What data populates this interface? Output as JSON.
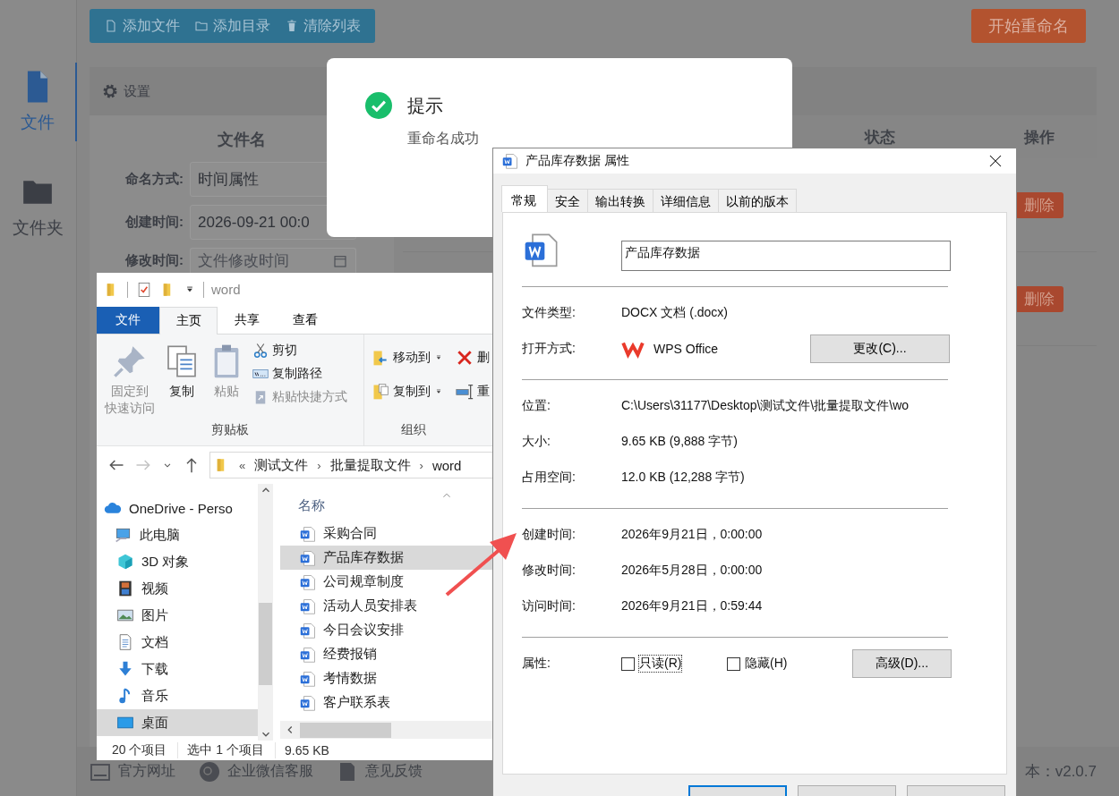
{
  "app": {
    "sidebar": [
      {
        "label": "文件",
        "selected": true
      },
      {
        "label": "文件夹",
        "selected": false
      }
    ],
    "toolbar": [
      "添加文件",
      "添加目录",
      "清除列表"
    ],
    "start_button": "开始重命名",
    "settings_title": "设置",
    "form": {
      "title": "文件名",
      "fields": [
        {
          "label": "命名方式:",
          "value": "时间属性"
        },
        {
          "label": "创建时间:",
          "value": "2026-09-21 00:0"
        },
        {
          "label": "修改时间:",
          "placeholder": "文件修改时间"
        }
      ]
    },
    "table": {
      "columns": [
        "状态",
        "操作"
      ],
      "rows": [
        {
          "action": "删除"
        },
        {
          "action": "删除"
        }
      ]
    },
    "footer": {
      "links": [
        "官方网址",
        "企业微信客服",
        "意见反馈"
      ],
      "version": "本：v2.0.7"
    }
  },
  "toast": {
    "title": "提示",
    "message": "重命名成功"
  },
  "explorer": {
    "title": "word",
    "file_tab": "文件",
    "tabs": [
      {
        "label": "主页",
        "selected": true
      },
      {
        "label": "共享",
        "selected": false
      },
      {
        "label": "查看",
        "selected": false
      }
    ],
    "clipboard": {
      "label": "剪贴板",
      "large": [
        {
          "lines": [
            "固定到",
            "快速访问"
          ],
          "disabled": true
        },
        {
          "lines": [
            "复制"
          ],
          "disabled": false
        },
        {
          "lines": [
            "粘贴"
          ],
          "disabled": true
        }
      ],
      "small": [
        {
          "label": "剪切",
          "disabled": false
        },
        {
          "label": "复制路径",
          "disabled": false
        },
        {
          "label": "粘贴快捷方式",
          "disabled": true
        }
      ]
    },
    "organize": {
      "label": "组织",
      "items": [
        {
          "label": "移动到",
          "dropdown": true
        },
        {
          "label": "删",
          "dropdown": false
        },
        {
          "label": "复制到",
          "dropdown": true
        },
        {
          "label": "重",
          "dropdown": false
        }
      ]
    },
    "nav_buttons": [
      {
        "disabled": false
      },
      {
        "disabled": true
      },
      {
        "disabled": false
      },
      {
        "disabled": false
      }
    ],
    "address": {
      "overflow": "«",
      "crumbs": [
        {
          "label": "测试文件"
        },
        {
          "separator": "›",
          "label": "批量提取文件"
        },
        {
          "separator": "›",
          "label": "word"
        }
      ]
    },
    "nav_pane": [
      {
        "label": "OneDrive - Perso",
        "selected": false
      },
      {
        "label": "此电脑",
        "selected": false,
        "children": [
          {
            "label": "3D 对象",
            "selected": false
          },
          {
            "label": "视频",
            "selected": false
          },
          {
            "label": "图片",
            "selected": false
          },
          {
            "label": "文档",
            "selected": false
          },
          {
            "label": "下载",
            "selected": false
          },
          {
            "label": "音乐",
            "selected": false
          },
          {
            "label": "桌面",
            "selected": true
          }
        ]
      }
    ],
    "column": "名称",
    "files": [
      {
        "name": "采购合同",
        "selected": false
      },
      {
        "name": "产品库存数据",
        "selected": true
      },
      {
        "name": "公司规章制度",
        "selected": false
      },
      {
        "name": "活动人员安排表",
        "selected": false
      },
      {
        "name": "今日会议安排",
        "selected": false
      },
      {
        "name": "经费报销",
        "selected": false
      },
      {
        "name": "考情数据",
        "selected": false
      },
      {
        "name": "客户联系表",
        "selected": false
      }
    ],
    "status": [
      "20 个项目",
      "选中 1 个项目",
      "9.65 KB"
    ]
  },
  "properties": {
    "title": "产品库存数据 属性",
    "tabs": [
      {
        "label": "常规",
        "selected": true
      },
      {
        "label": "安全",
        "selected": false
      },
      {
        "label": "输出转换",
        "selected": false
      },
      {
        "label": "详细信息",
        "selected": false
      },
      {
        "label": "以前的版本",
        "selected": false
      }
    ],
    "name": "产品库存数据",
    "sections": [
      [
        {
          "kind": "text",
          "label": "文件类型:",
          "value": "DOCX 文档 (.docx)"
        },
        {
          "kind": "app",
          "label": "打开方式:",
          "value": "WPS Office",
          "button": "更改(C)..."
        }
      ],
      [
        {
          "kind": "text",
          "label": "位置:",
          "value": "C:\\Users\\31177\\Desktop\\测试文件\\批量提取文件\\wo"
        },
        {
          "kind": "text",
          "label": "大小:",
          "value": "9.65 KB (9,888 字节)"
        },
        {
          "kind": "text",
          "label": "占用空间:",
          "value": "12.0 KB (12,288 字节)"
        }
      ],
      [
        {
          "kind": "text",
          "label": "创建时间:",
          "value": "2026年9月21日，0:00:00"
        },
        {
          "kind": "text",
          "label": "修改时间:",
          "value": "2026年5月28日，0:00:00"
        },
        {
          "kind": "text",
          "label": "访问时间:",
          "value": "2026年9月21日，0:59:44"
        }
      ]
    ],
    "attributes": {
      "label": "属性:",
      "checkboxes": [
        {
          "label": "只读(R)",
          "checked": false,
          "focused": true
        },
        {
          "label": "隐藏(H)",
          "checked": false,
          "focused": false
        }
      ],
      "button": "高级(D)..."
    },
    "bottom_buttons": [
      {
        "default": true
      },
      {
        "default": false
      },
      {
        "default": false
      }
    ]
  }
}
